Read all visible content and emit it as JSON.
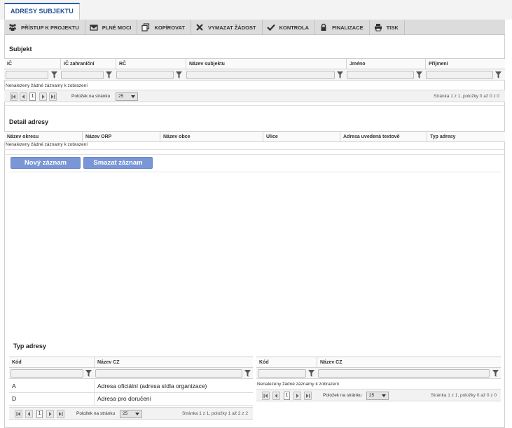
{
  "tab": {
    "label": "ADRESY SUBJEKTU"
  },
  "toolbar": {
    "items": [
      {
        "label": "PŘÍSTUP K PROJEKTU",
        "icon": "people-icon"
      },
      {
        "label": "PLNÉ MOCI",
        "icon": "envelope-icon"
      },
      {
        "label": "KOPÍROVAT",
        "icon": "copy-icon"
      },
      {
        "label": "VYMAZAT ŽÁDOST",
        "icon": "x-icon"
      },
      {
        "label": "KONTROLA",
        "icon": "check-icon"
      },
      {
        "label": "FINALIZACE",
        "icon": "lock-icon"
      },
      {
        "label": "TISK",
        "icon": "printer-icon"
      }
    ]
  },
  "subjekt": {
    "title": "Subjekt",
    "columns": [
      "IČ",
      "IČ zahraniční",
      "RČ",
      "Název subjektu",
      "Jméno",
      "Příjmení"
    ],
    "no_records": "Nenalezeny žádné záznamy k zobrazení",
    "pager": {
      "page": "1",
      "per_page_label": "Položek na stránku",
      "per_page": "25",
      "info": "Stránka 1 z 1, položky 0 až 0 z 0"
    }
  },
  "detail": {
    "title": "Detail adresy",
    "columns": [
      "Název okresu",
      "Název ORP",
      "Název obce",
      "Ulice",
      "Adresa uvedená textově",
      "Typ adresy"
    ],
    "no_records": "Nenalezeny žádné záznamy k zobrazení",
    "new_button": "Nový záznam",
    "delete_button": "Smazat záznam"
  },
  "typ_adresy": {
    "title": "Typ adresy",
    "left": {
      "columns": [
        "Kód",
        "Název CZ"
      ],
      "rows": [
        {
          "kod": "A",
          "nazev": "Adresa oficiální (adresa sídla organizace)"
        },
        {
          "kod": "D",
          "nazev": "Adresa pro doručení"
        }
      ],
      "pager": {
        "page": "1",
        "per_page_label": "Položek na stránku",
        "per_page": "25",
        "info": "Stránka 1 z 1, položky 1 až 2 z 2"
      }
    },
    "right": {
      "columns": [
        "Kód",
        "Název CZ"
      ],
      "no_records": "Nenalezeny žádné záznamy k zobrazení",
      "pager": {
        "page": "1",
        "per_page_label": "Položek na stránku",
        "per_page": "25",
        "info": "Stránka 1 z 1, položky 0 až 0 z 0"
      }
    }
  },
  "colors": {
    "accent": "#2a5ca8",
    "button": "#7b96d6",
    "toolbar": "#dcdcdc"
  }
}
